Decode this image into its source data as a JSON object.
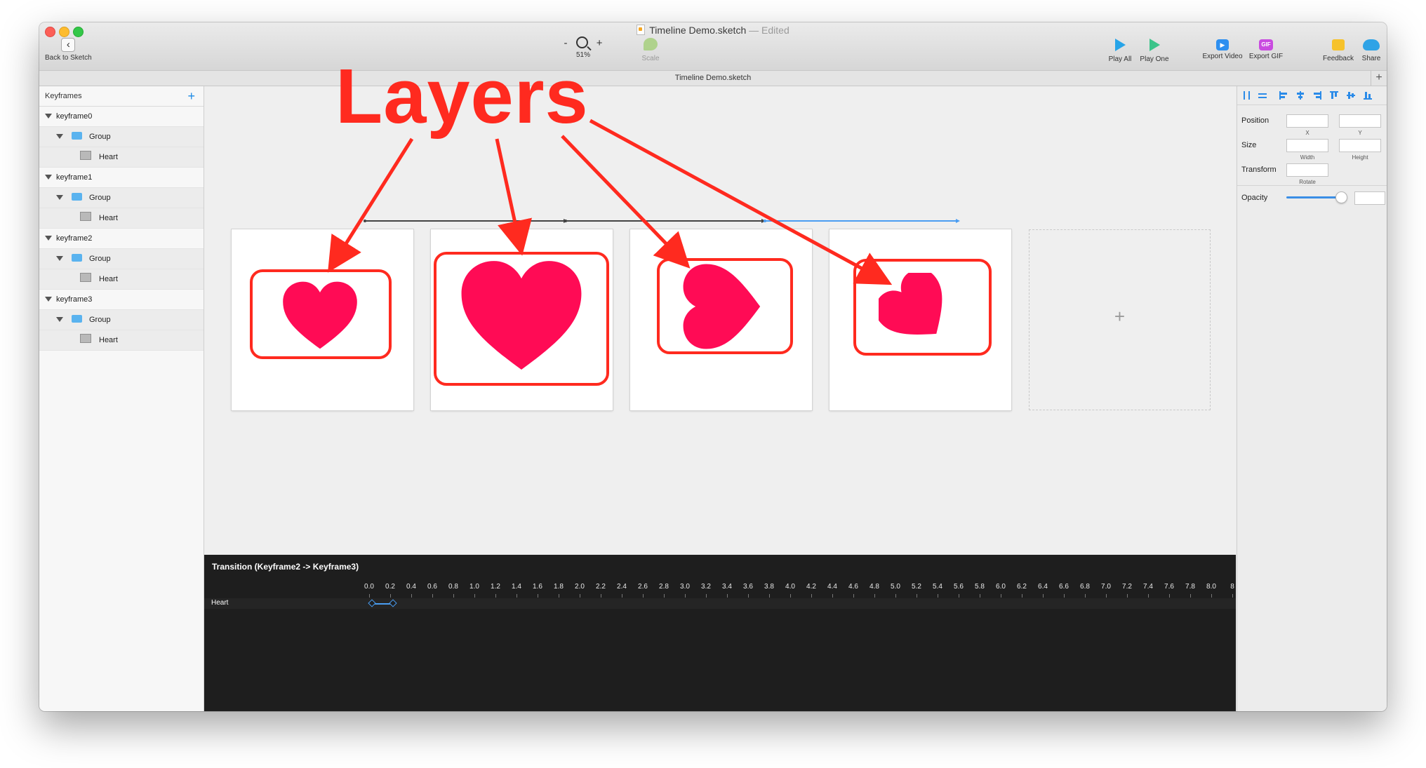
{
  "window": {
    "title": "Timeline Demo.sketch",
    "title_status": "— Edited",
    "doc_tab": "Timeline Demo.sketch"
  },
  "toolbar": {
    "back_label": "Back to Sketch",
    "zoom_minus": "-",
    "zoom_plus": "+",
    "zoom_level": "51%",
    "scale_label": "Scale",
    "play_all_label": "Play All",
    "play_one_label": "Play One",
    "export_video_label": "Export Video",
    "export_gif_label": "Export GIF",
    "gif_icon_text": "GIF",
    "feedback_label": "Feedback",
    "share_label": "Share"
  },
  "sidebar": {
    "header": "Keyframes",
    "add_symbol": "+",
    "keyframes": [
      {
        "name": "keyframe0",
        "group": "Group",
        "layer": "Heart"
      },
      {
        "name": "keyframe1",
        "group": "Group",
        "layer": "Heart"
      },
      {
        "name": "keyframe2",
        "group": "Group",
        "layer": "Heart"
      },
      {
        "name": "keyframe3",
        "group": "Group",
        "layer": "Heart"
      }
    ]
  },
  "canvas": {
    "annotation_label": "Layers",
    "empty_slot_symbol": "+",
    "heart_color": "#ff0b55",
    "annotation_color": "#ff2a1f"
  },
  "timeline": {
    "title": "Transition (Keyframe2 -> Keyframe3)",
    "track_label": "Heart",
    "ruler": [
      "0.0",
      "0.2",
      "0.4",
      "0.6",
      "0.8",
      "1.0",
      "1.2",
      "1.4",
      "1.6",
      "1.8",
      "2.0",
      "2.2",
      "2.4",
      "2.6",
      "2.8",
      "3.0",
      "3.2",
      "3.4",
      "3.6",
      "3.8",
      "4.0",
      "4.2",
      "4.4",
      "4.6",
      "4.8",
      "5.0",
      "5.2",
      "5.4",
      "5.6",
      "5.8",
      "6.0",
      "6.2",
      "6.4",
      "6.6",
      "6.8",
      "7.0",
      "7.2",
      "7.4",
      "7.6",
      "7.8",
      "8.0",
      "8"
    ],
    "keyframe_span": [
      0.0,
      0.2
    ]
  },
  "inspector": {
    "position_label": "Position",
    "x_label": "X",
    "y_label": "Y",
    "size_label": "Size",
    "width_label": "Width",
    "height_label": "Height",
    "transform_label": "Transform",
    "rotate_label": "Rotate",
    "opacity_label": "Opacity",
    "opacity_value": 0.9
  }
}
